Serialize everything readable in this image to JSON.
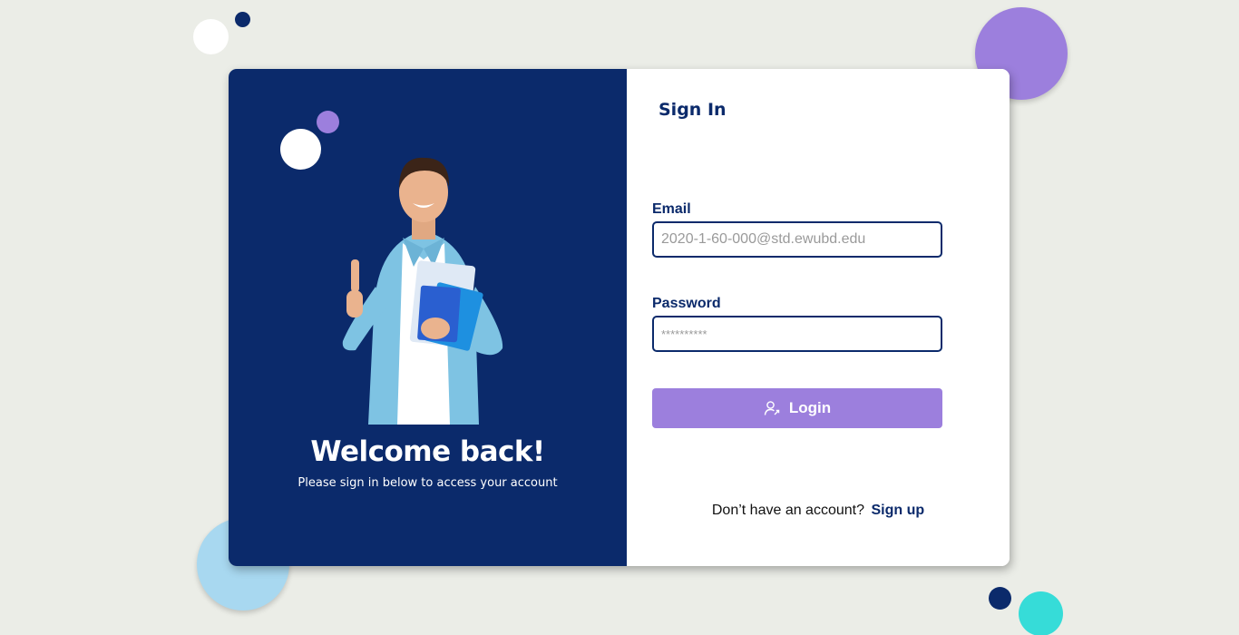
{
  "welcome": {
    "title": "Welcome back!",
    "subtitle": "Please sign in below to access your account"
  },
  "signin": {
    "title": "Sign In",
    "email_label": "Email",
    "email_placeholder": "2020-1-60-000@std.ewubd.edu",
    "password_label": "Password",
    "password_placeholder": "**********",
    "login_label": "Login",
    "login_icon": "user-login-icon",
    "no_account_text": "Don’t have an account?",
    "signup_label": "Sign up"
  },
  "colors": {
    "navy": "#0b2a6b",
    "purple": "#9c7fdd",
    "light_blue": "#a8d8f0",
    "teal": "#36dcd8",
    "background": "#ebede7"
  }
}
